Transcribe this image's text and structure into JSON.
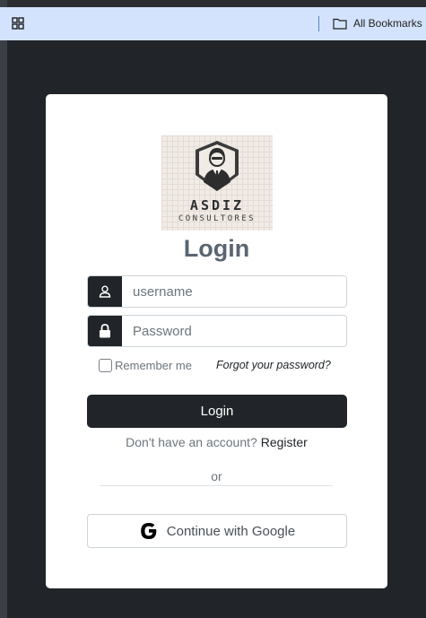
{
  "browser": {
    "bookmarks_label": "All Bookmarks"
  },
  "logo": {
    "brand": "ASDIZ",
    "subtitle": "CONSULTORES"
  },
  "login_form": {
    "title": "Login",
    "username_placeholder": "username",
    "password_placeholder": "Password",
    "remember_label": "Remember me",
    "forgot_link": "Forgot your password?",
    "submit_label": "Login",
    "no_account_text": "Don't have an account?",
    "register_link": "Register",
    "or_text": "or",
    "google_button_label": "Continue with Google"
  },
  "icons": {
    "apps": "apps-grid-icon",
    "folder": "folder-icon",
    "user": "user-icon",
    "lock": "lock-icon",
    "google": "google-g-icon"
  },
  "colors": {
    "page_background": "#212529",
    "card_background": "#ffffff",
    "primary_button": "#212529",
    "title_text": "#5a6572",
    "bookmarks_bar": "#d3e3fd"
  }
}
